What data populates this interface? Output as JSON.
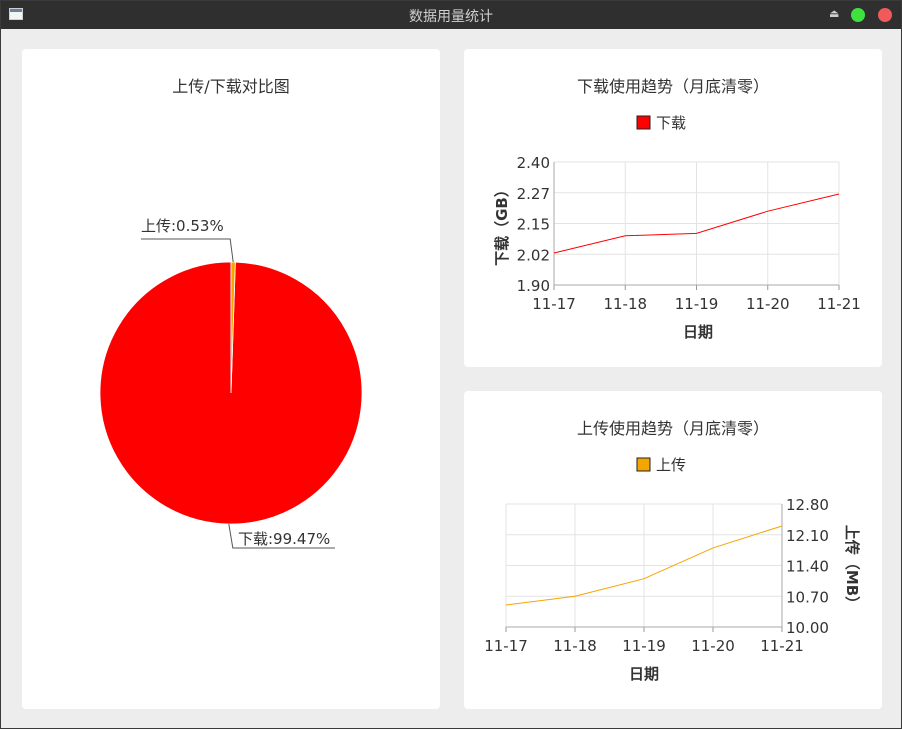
{
  "window": {
    "title": "数据用量统计",
    "icons": {
      "app": "window-app-icon",
      "eject": "eject-icon",
      "maximize": "green-dot-icon",
      "close": "red-dot-icon"
    }
  },
  "pie_panel": {
    "title": "上传/下载对比图",
    "labels": {
      "upload": "上传:0.53%",
      "download": "下载:99.47%"
    }
  },
  "download_panel": {
    "title": "下载使用趋势（月底清零）",
    "legend": "下载",
    "xlabel": "日期",
    "ylabel": "下载（GB）",
    "yticks": [
      "2.40",
      "2.27",
      "2.15",
      "2.02",
      "1.90"
    ],
    "xticks": [
      "11-17",
      "11-18",
      "11-19",
      "11-20",
      "11-21"
    ]
  },
  "upload_panel": {
    "title": "上传使用趋势（月底清零）",
    "legend": "上传",
    "xlabel": "日期",
    "ylabel": "上传（MB）",
    "yticks": [
      "12.80",
      "12.10",
      "11.40",
      "10.70",
      "10.00"
    ],
    "xticks": [
      "11-17",
      "11-18",
      "11-19",
      "11-20",
      "11-21"
    ]
  },
  "colors": {
    "download": "#ff0000",
    "upload": "#f5a500"
  },
  "chart_data": [
    {
      "type": "pie",
      "title": "上传/下载对比图",
      "categories": [
        "上传",
        "下载"
      ],
      "values": [
        0.53,
        99.47
      ],
      "colors": [
        "#f5a500",
        "#ff0000"
      ]
    },
    {
      "type": "line",
      "title": "下载使用趋势（月底清零）",
      "x": [
        "11-17",
        "11-18",
        "11-19",
        "11-20",
        "11-21"
      ],
      "series": [
        {
          "name": "下载",
          "values": [
            2.03,
            2.1,
            2.11,
            2.2,
            2.27
          ]
        }
      ],
      "xlabel": "日期",
      "ylabel": "下载（GB）",
      "ylim": [
        1.9,
        2.4
      ],
      "grid": true,
      "legend": "top"
    },
    {
      "type": "line",
      "title": "上传使用趋势（月底清零）",
      "x": [
        "11-17",
        "11-18",
        "11-19",
        "11-20",
        "11-21"
      ],
      "series": [
        {
          "name": "上传",
          "values": [
            10.5,
            10.7,
            11.1,
            11.8,
            12.3
          ]
        }
      ],
      "xlabel": "日期",
      "ylabel": "上传（MB）",
      "ylim": [
        10.0,
        12.8
      ],
      "grid": true,
      "legend": "top"
    }
  ]
}
